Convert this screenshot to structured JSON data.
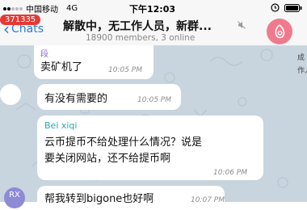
{
  "status_bar": {
    "carrier": "中国移动",
    "network": "4G",
    "time": "下午12:03"
  },
  "header": {
    "back_label": "Chats",
    "unread_badge": "371335",
    "title": "解散中，无工作人员，新群...",
    "subtitle": "18900 members, 3 online",
    "avatar_color": "#f07a8c"
  },
  "messages": [
    {
      "sender": "段",
      "text": "卖矿机了",
      "time": "10:05 PM"
    },
    {
      "sender": "",
      "text": "有没有需要的",
      "time": "10:05 PM"
    },
    {
      "sender": "Bei xiqi",
      "text_line1": "云币提币不给处理什么情况？说是",
      "text_line2": "要关闭网站，还不给提币啊",
      "time": "10:06 PM"
    },
    {
      "sender": "",
      "text": "帮我转到bigone也好啊",
      "time": "10:07 PM"
    }
  ],
  "next_sender_avatar_initials": "RX",
  "right_edge_text": [
    "成",
    "作人"
  ],
  "colors": {
    "accent": "#2a7cd6",
    "badge": "#e53935",
    "sender_name": "#2aa6b8",
    "wallpaper": "#c8d4de",
    "rx_avatar": "#8e8ad6"
  }
}
